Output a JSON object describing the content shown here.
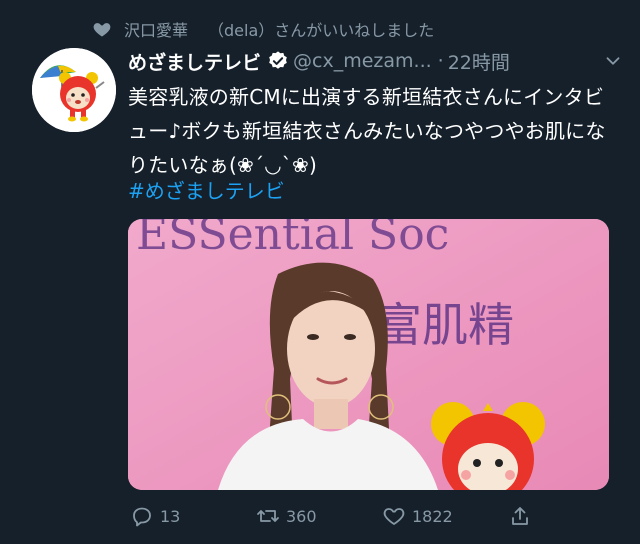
{
  "social_context": {
    "icon": "heart-icon",
    "liker_name": "沢口愛華",
    "liked_text": "（dela）さんがいいねしました"
  },
  "tweet": {
    "avatar_icon": "mezamashi-mascot-avatar",
    "display_name": "めざましテレビ",
    "verified_icon": "verified-badge-icon",
    "handle": "@cx_mezam...",
    "separator": "·",
    "time": "22時間",
    "menu_icon": "chevron-down-icon",
    "text": "美容乳液の新CMに出演する新垣結衣さんにインタビュー♪ボクも新垣結衣さんみたいなつやつやお肌になりたいなぁ(❀´◡`❀)",
    "hashtag": "#めざましテレビ",
    "media": {
      "sign_text_top": "ESSential Soc",
      "sign_text_jp": "富肌精"
    }
  },
  "actions": {
    "reply_icon": "reply-icon",
    "reply_count": "13",
    "retweet_icon": "retweet-icon",
    "retweet_count": "360",
    "like_icon": "heart-outline-icon",
    "like_count": "1822",
    "share_icon": "share-icon"
  },
  "colors": {
    "background": "#15202b",
    "secondary_text": "#8899a6",
    "link": "#1da1f2",
    "verified_badge": "#ffffff"
  }
}
